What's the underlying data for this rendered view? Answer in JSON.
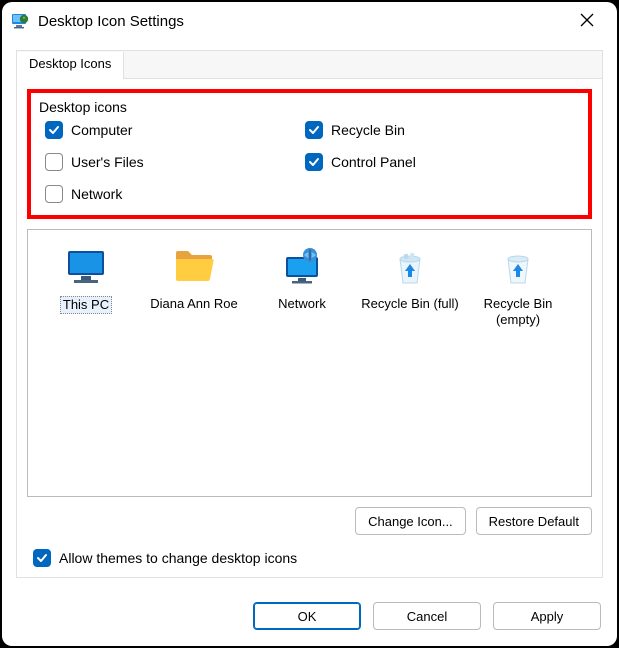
{
  "window_title": "Desktop Icon Settings",
  "tab_label": "Desktop Icons",
  "group_title": "Desktop icons",
  "checkboxes": {
    "computer": {
      "label": "Computer",
      "checked": true
    },
    "recycle_bin": {
      "label": "Recycle Bin",
      "checked": true
    },
    "users_files": {
      "label": "User's Files",
      "checked": false
    },
    "control_panel": {
      "label": "Control Panel",
      "checked": true
    },
    "network": {
      "label": "Network",
      "checked": false
    }
  },
  "icons": [
    {
      "id": "this-pc",
      "label": "This PC",
      "kind": "monitor",
      "selected": true
    },
    {
      "id": "user-folder",
      "label": "Diana Ann Roe",
      "kind": "folder",
      "selected": false
    },
    {
      "id": "network",
      "label": "Network",
      "kind": "net-monitor",
      "selected": false
    },
    {
      "id": "recycle-full",
      "label": "Recycle Bin (full)",
      "kind": "bin-full",
      "selected": false
    },
    {
      "id": "recycle-empty",
      "label": "Recycle Bin (empty)",
      "kind": "bin-empty",
      "selected": false
    }
  ],
  "buttons": {
    "change_icon": "Change Icon...",
    "restore_default": "Restore Default",
    "ok": "OK",
    "cancel": "Cancel",
    "apply": "Apply"
  },
  "allow_themes": {
    "label": "Allow themes to change desktop icons",
    "checked": true
  },
  "colors": {
    "accent": "#0067c0",
    "highlight_border": "#ff0000"
  }
}
